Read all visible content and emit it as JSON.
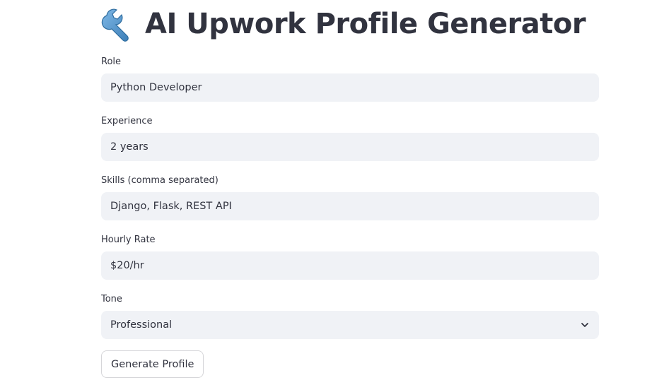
{
  "header": {
    "title": "AI Upwork Profile Generator",
    "icon": "wrench-icon"
  },
  "form": {
    "role": {
      "label": "Role",
      "value": "Python Developer"
    },
    "experience": {
      "label": "Experience",
      "value": "2 years"
    },
    "skills": {
      "label": "Skills (comma separated)",
      "value": "Django, Flask, REST API"
    },
    "hourly_rate": {
      "label": "Hourly Rate",
      "value": "$20/hr"
    },
    "tone": {
      "label": "Tone",
      "selected": "Professional"
    },
    "submit_label": "Generate Profile"
  },
  "colors": {
    "input_background": "#f0f2f6",
    "text": "#31333f",
    "wrench_blue": "#4a90c8"
  }
}
